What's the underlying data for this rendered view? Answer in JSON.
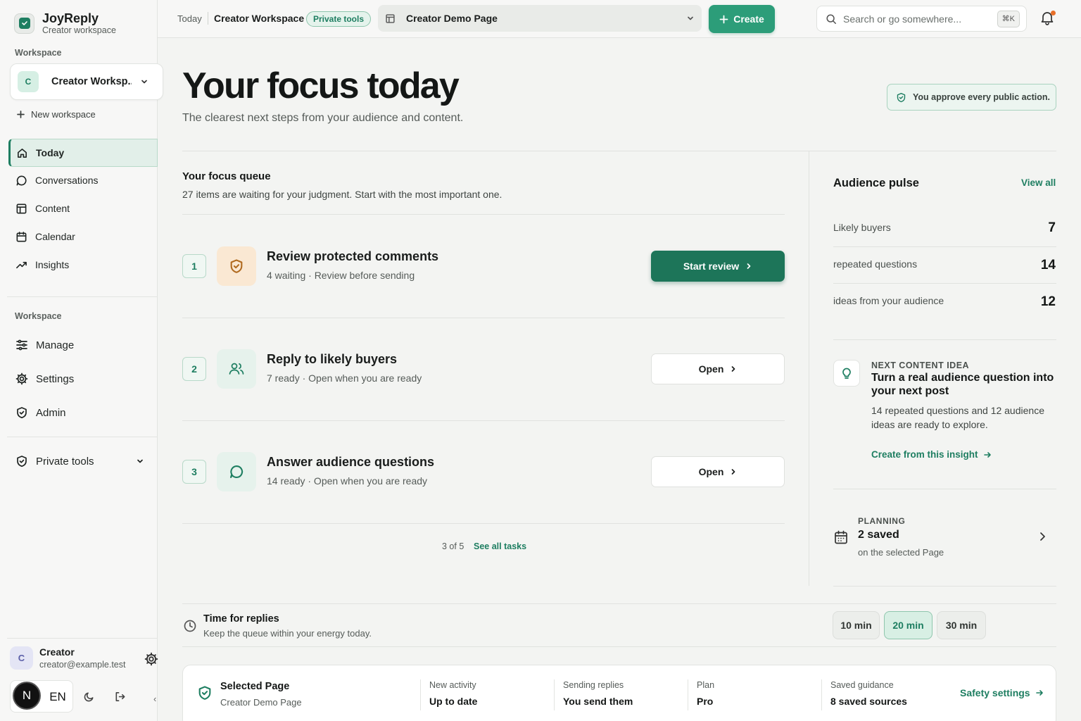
{
  "brand": {
    "name": "JoyReply",
    "subtitle": "Creator workspace"
  },
  "sidebar": {
    "workspace_label": "Workspace",
    "workspace_avatar": "C",
    "workspace_name": "Creator Worksp...",
    "new_workspace": "New workspace",
    "nav": [
      {
        "label": "Today",
        "icon": "home-icon",
        "active": true
      },
      {
        "label": "Conversations",
        "icon": "chat-icon"
      },
      {
        "label": "Content",
        "icon": "layout-icon"
      },
      {
        "label": "Calendar",
        "icon": "calendar-icon"
      },
      {
        "label": "Insights",
        "icon": "trend-icon"
      }
    ],
    "section2_label": "Workspace",
    "nav2": [
      {
        "label": "Manage",
        "icon": "sliders-icon"
      },
      {
        "label": "Settings",
        "icon": "gear-icon"
      },
      {
        "label": "Admin",
        "icon": "shield-icon"
      }
    ],
    "private_tools": "Private tools",
    "user": {
      "avatar": "C",
      "name": "Creator",
      "email": "creator@example.test"
    },
    "badge_letter": "N",
    "language": "EN"
  },
  "topbar": {
    "crumb_today": "Today",
    "crumb_workspace": "Creator Workspace",
    "private_badge": "Private tools",
    "page_select": "Creator Demo Page",
    "create_label": "Create",
    "search_placeholder": "Search or go somewhere...",
    "search_kbd": "⌘K"
  },
  "header": {
    "title": "Your focus today",
    "subtitle": "The clearest next steps from your audience and content.",
    "approve_note": "You approve every public action."
  },
  "queue": {
    "title": "Your focus queue",
    "subtitle": "27 items are waiting for your judgment. Start with the most important one.",
    "tasks": [
      {
        "num": "1",
        "title": "Review protected comments",
        "meta": "4 waiting · Review before sending",
        "button": "Start review",
        "icon": "shield-check-icon"
      },
      {
        "num": "2",
        "title": "Reply to likely buyers",
        "meta": "7 ready · Open when you are ready",
        "button": "Open",
        "icon": "users-icon"
      },
      {
        "num": "3",
        "title": "Answer audience questions",
        "meta": "14 ready · Open when you are ready",
        "button": "Open",
        "icon": "chat-icon"
      }
    ],
    "pager": "3 of 5",
    "see_all": "See all tasks"
  },
  "pulse": {
    "title": "Audience pulse",
    "view_all": "View all",
    "stats": [
      {
        "label": "Likely buyers",
        "value": "7"
      },
      {
        "label": "repeated questions",
        "value": "14"
      },
      {
        "label": "ideas from your audience",
        "value": "12"
      }
    ]
  },
  "idea": {
    "kicker": "NEXT CONTENT IDEA",
    "title": "Turn a real audience question into your next post",
    "body": "14 repeated questions and 12 audience ideas are ready to explore.",
    "link": "Create from this insight"
  },
  "planning": {
    "kicker": "PLANNING",
    "value": "2 saved",
    "sub": "on the selected Page"
  },
  "time": {
    "title": "Time for replies",
    "subtitle": "Keep the queue within your energy today.",
    "options": [
      "10 min",
      "20 min",
      "30 min"
    ],
    "selected": "20 min"
  },
  "footer": {
    "title": "Selected Page",
    "page": "Creator Demo Page",
    "cols": [
      {
        "label": "New activity",
        "value": "Up to date"
      },
      {
        "label": "Sending replies",
        "value": "You send them"
      },
      {
        "label": "Plan",
        "value": "Pro"
      },
      {
        "label": "Saved guidance",
        "value": "8 saved sources"
      }
    ],
    "link": "Safety settings"
  },
  "colors": {
    "accent": "#1e7e61",
    "accent_button": "#2c9d79",
    "warm_icon_bg": "#fae8d3"
  }
}
